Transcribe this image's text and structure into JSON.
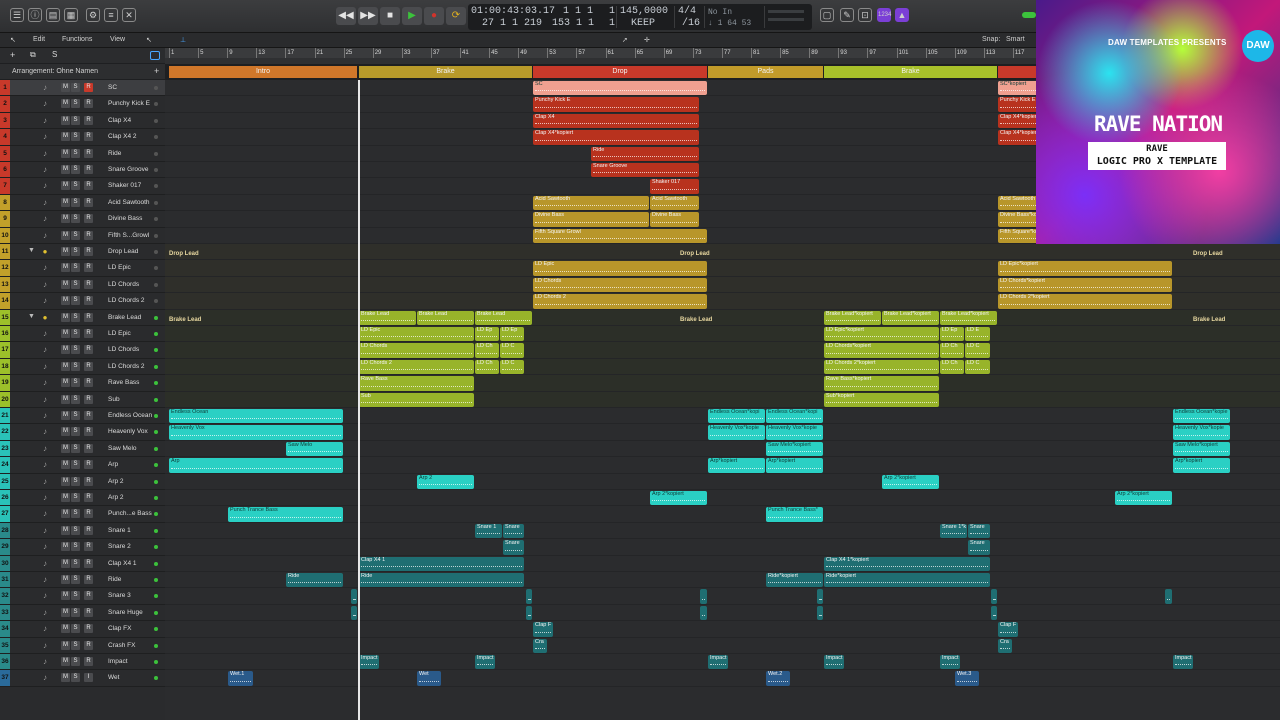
{
  "lcd": {
    "time": "01:00:43:03.17",
    "bars_beats": "1  1  1",
    "sub1": "1",
    "bars2": "27  1  1  219",
    "bars3": "153  1  1",
    "sub2": "1",
    "tempo": "145,0000",
    "tempo_mode": "KEEP",
    "signature": "4/4",
    "division": "/16",
    "in_label": "No In",
    "out_label": "↓ 1  64  53"
  },
  "menus": {
    "edit": "Edit",
    "functions": "Functions",
    "view": "View",
    "snap_label": "Snap:",
    "snap_value": "Smart"
  },
  "arrangement_label": "Arrangement: Ohne Namen",
  "ruler_ticks": [
    "1",
    "5",
    "9",
    "13",
    "17",
    "21",
    "25",
    "29",
    "33",
    "37",
    "41",
    "45",
    "49",
    "53",
    "57",
    "61",
    "65",
    "69",
    "73",
    "77",
    "81",
    "85",
    "89",
    "93",
    "97",
    "101",
    "105",
    "109",
    "113",
    "117",
    "121"
  ],
  "markers": [
    {
      "label": "Intro",
      "color": "#d0772a"
    },
    {
      "label": "Brake",
      "color": "#b89a2a"
    },
    {
      "label": "Drop",
      "color": "#c8392a"
    },
    {
      "label": "Pads",
      "color": "#c29b2a"
    },
    {
      "label": "Brake",
      "color": "#a8c02a"
    },
    {
      "label": "",
      "color": "#c8392a"
    }
  ],
  "tracks": [
    {
      "num": "1",
      "name": "SC",
      "color": "#c8392a"
    },
    {
      "num": "2",
      "name": "Punchy Kick E",
      "color": "#c8392a"
    },
    {
      "num": "3",
      "name": "Clap X4",
      "color": "#c8392a"
    },
    {
      "num": "4",
      "name": "Clap X4 2",
      "color": "#c8392a"
    },
    {
      "num": "5",
      "name": "Ride",
      "color": "#c8392a"
    },
    {
      "num": "6",
      "name": "Snare Groove",
      "color": "#c8392a"
    },
    {
      "num": "7",
      "name": "Shaker 017",
      "color": "#c8392a"
    },
    {
      "num": "8",
      "name": "Acid Sawtooth",
      "color": "#c2a02a"
    },
    {
      "num": "9",
      "name": "Divine Bass",
      "color": "#c2a02a"
    },
    {
      "num": "10",
      "name": "Fifth S...Growl",
      "color": "#c2a02a"
    },
    {
      "num": "11",
      "name": "Drop Lead",
      "color": "#c2a02a"
    },
    {
      "num": "12",
      "name": "LD Epic",
      "color": "#c2a02a"
    },
    {
      "num": "13",
      "name": "LD Chords",
      "color": "#c2a02a"
    },
    {
      "num": "14",
      "name": "LD Chords 2",
      "color": "#c2a02a"
    },
    {
      "num": "15",
      "name": "Brake Lead",
      "color": "#9cc02a"
    },
    {
      "num": "16",
      "name": "LD Epic",
      "color": "#9cc02a"
    },
    {
      "num": "17",
      "name": "LD Chords",
      "color": "#9cc02a"
    },
    {
      "num": "18",
      "name": "LD Chords 2",
      "color": "#9cc02a"
    },
    {
      "num": "19",
      "name": "Rave Bass",
      "color": "#9cc02a"
    },
    {
      "num": "20",
      "name": "Sub",
      "color": "#9cc02a"
    },
    {
      "num": "21",
      "name": "Endless Ocean",
      "color": "#2ac2b8"
    },
    {
      "num": "22",
      "name": "Heavenly Vox",
      "color": "#2ac2b8"
    },
    {
      "num": "23",
      "name": "Saw Melo",
      "color": "#2ac2b8"
    },
    {
      "num": "24",
      "name": "Arp",
      "color": "#2ac2b8"
    },
    {
      "num": "25",
      "name": "Arp 2",
      "color": "#2ac2b8"
    },
    {
      "num": "26",
      "name": "Arp 2",
      "color": "#2ac2b8"
    },
    {
      "num": "27",
      "name": "Punch...e Bass",
      "color": "#2ac2b8"
    },
    {
      "num": "28",
      "name": "Snare 1",
      "color": "#2a8a8a"
    },
    {
      "num": "29",
      "name": "Snare 2",
      "color": "#2a8a8a"
    },
    {
      "num": "30",
      "name": "Clap X4 1",
      "color": "#2a8a8a"
    },
    {
      "num": "31",
      "name": "Ride",
      "color": "#2a8a8a"
    },
    {
      "num": "32",
      "name": "Snare 3",
      "color": "#2a8a8a"
    },
    {
      "num": "33",
      "name": "Snare Huge",
      "color": "#2a8a8a"
    },
    {
      "num": "34",
      "name": "Clap FX",
      "color": "#2a8a8a"
    },
    {
      "num": "35",
      "name": "Crash FX",
      "color": "#2a8a8a"
    },
    {
      "num": "36",
      "name": "Impact",
      "color": "#2a8a8a"
    },
    {
      "num": "37",
      "name": "Wet",
      "color": "#2a6a9a"
    }
  ],
  "folder_labels": {
    "drop_lead_a": "Drop Lead",
    "drop_lead_b": "Drop Lead",
    "drop_lead_c": "Drop Lead",
    "brake_lead_a": "Brake Lead",
    "brake_lead_b": "Brake Lead",
    "brake_lead_c": "Brake Lead"
  },
  "regions": [
    {
      "lane": 0,
      "label": "SC",
      "color": "#f0a090",
      "start": 533,
      "end": 707
    },
    {
      "lane": 0,
      "label": "SC*kopiert",
      "color": "#f0a090",
      "start": 998,
      "end": 1040
    },
    {
      "lane": 1,
      "label": "Punchy Kick E",
      "color": "#b8321e",
      "start": 533,
      "end": 699
    },
    {
      "lane": 1,
      "label": "Punchy Kick E",
      "color": "#b8321e",
      "start": 998,
      "end": 1040
    },
    {
      "lane": 2,
      "label": "Clap X4",
      "color": "#b8321e",
      "start": 533,
      "end": 699
    },
    {
      "lane": 2,
      "label": "Clap X4*kopiert",
      "color": "#b8321e",
      "start": 998,
      "end": 1040
    },
    {
      "lane": 3,
      "label": "Clap X4*kopiert",
      "color": "#b8321e",
      "start": 533,
      "end": 699
    },
    {
      "lane": 3,
      "label": "Clap X4*kopiert",
      "color": "#b8321e",
      "start": 998,
      "end": 1040
    },
    {
      "lane": 4,
      "label": "Ride",
      "color": "#b8321e",
      "start": 591,
      "end": 699
    },
    {
      "lane": 5,
      "label": "Snare Groove",
      "color": "#b8321e",
      "start": 591,
      "end": 699
    },
    {
      "lane": 6,
      "label": "Shaker 017",
      "color": "#b8321e",
      "start": 650,
      "end": 699
    },
    {
      "lane": 7,
      "label": "Acid Sawtooth",
      "color": "#b8962a",
      "start": 533,
      "end": 649
    },
    {
      "lane": 7,
      "label": "Acid Sawtooth",
      "color": "#b8962a",
      "start": 650,
      "end": 699
    },
    {
      "lane": 7,
      "label": "Acid Sawtooth",
      "color": "#b8962a",
      "start": 998,
      "end": 1040
    },
    {
      "lane": 8,
      "label": "Divine Bass",
      "color": "#b8962a",
      "start": 533,
      "end": 649
    },
    {
      "lane": 8,
      "label": "Divine Bass",
      "color": "#b8962a",
      "start": 650,
      "end": 699
    },
    {
      "lane": 8,
      "label": "Divine Bass*kopiert",
      "color": "#b8962a",
      "start": 998,
      "end": 1040
    },
    {
      "lane": 9,
      "label": "Fifth Square Growl",
      "color": "#b8962a",
      "start": 533,
      "end": 707
    },
    {
      "lane": 9,
      "label": "Fifth Square*kopiert",
      "color": "#b8962a",
      "start": 998,
      "end": 1040
    },
    {
      "lane": 11,
      "label": "LD Epic",
      "color": "#b8962a",
      "start": 533,
      "end": 707
    },
    {
      "lane": 11,
      "label": "LD Epic*kopiert",
      "color": "#b8962a",
      "start": 998,
      "end": 1172
    },
    {
      "lane": 12,
      "label": "LD Chords",
      "color": "#b8962a",
      "start": 533,
      "end": 707
    },
    {
      "lane": 12,
      "label": "LD Chords*kopiert",
      "color": "#b8962a",
      "start": 998,
      "end": 1172
    },
    {
      "lane": 13,
      "label": "LD Chords 2",
      "color": "#b8962a",
      "start": 533,
      "end": 707
    },
    {
      "lane": 13,
      "label": "LD Chords 2*kopiert",
      "color": "#b8962a",
      "start": 998,
      "end": 1172
    },
    {
      "lane": 14,
      "label": "Brake Lead",
      "color": "#98b42a",
      "start": 359,
      "end": 416
    },
    {
      "lane": 14,
      "label": "Brake Lead",
      "color": "#98b42a",
      "start": 417,
      "end": 474
    },
    {
      "lane": 14,
      "label": "Brake Lead",
      "color": "#98b42a",
      "start": 475,
      "end": 532
    },
    {
      "lane": 14,
      "label": "Brake Lead*kopiert",
      "color": "#98b42a",
      "start": 824,
      "end": 881
    },
    {
      "lane": 14,
      "label": "Brake Lead*kopiert",
      "color": "#98b42a",
      "start": 882,
      "end": 939
    },
    {
      "lane": 14,
      "label": "Brake Lead*kopiert",
      "color": "#98b42a",
      "start": 940,
      "end": 997
    },
    {
      "lane": 15,
      "label": "LD Epic",
      "color": "#98b42a",
      "start": 359,
      "end": 474
    },
    {
      "lane": 15,
      "label": "LD Ep",
      "color": "#98b42a",
      "start": 475,
      "end": 499
    },
    {
      "lane": 15,
      "label": "LD Ep",
      "color": "#98b42a",
      "start": 500,
      "end": 524
    },
    {
      "lane": 15,
      "label": "LD Epic*kopiert",
      "color": "#98b42a",
      "start": 824,
      "end": 939
    },
    {
      "lane": 15,
      "label": "LD Ep",
      "color": "#98b42a",
      "start": 940,
      "end": 964
    },
    {
      "lane": 15,
      "label": "LD E",
      "color": "#98b42a",
      "start": 965,
      "end": 990
    },
    {
      "lane": 16,
      "label": "LD Chords",
      "color": "#98b42a",
      "start": 359,
      "end": 474
    },
    {
      "lane": 16,
      "label": "LD Ch",
      "color": "#98b42a",
      "start": 475,
      "end": 499
    },
    {
      "lane": 16,
      "label": "LD C",
      "color": "#98b42a",
      "start": 500,
      "end": 524
    },
    {
      "lane": 16,
      "label": "LD Chords*kopiert",
      "color": "#98b42a",
      "start": 824,
      "end": 939
    },
    {
      "lane": 16,
      "label": "LD Ch",
      "color": "#98b42a",
      "start": 940,
      "end": 964
    },
    {
      "lane": 16,
      "label": "LD C",
      "color": "#98b42a",
      "start": 965,
      "end": 990
    },
    {
      "lane": 17,
      "label": "LD Chords 2",
      "color": "#98b42a",
      "start": 359,
      "end": 474
    },
    {
      "lane": 17,
      "label": "LD Ch",
      "color": "#98b42a",
      "start": 475,
      "end": 499
    },
    {
      "lane": 17,
      "label": "LD C",
      "color": "#98b42a",
      "start": 500,
      "end": 524
    },
    {
      "lane": 17,
      "label": "LD Chords 2*kopiert",
      "color": "#98b42a",
      "start": 824,
      "end": 939
    },
    {
      "lane": 17,
      "label": "LD Ch",
      "color": "#98b42a",
      "start": 940,
      "end": 964
    },
    {
      "lane": 17,
      "label": "LD C",
      "color": "#98b42a",
      "start": 965,
      "end": 990
    },
    {
      "lane": 18,
      "label": "Rave Bass",
      "color": "#98b42a",
      "start": 359,
      "end": 474
    },
    {
      "lane": 18,
      "label": "Rave Bass*kopiert",
      "color": "#98b42a",
      "start": 824,
      "end": 939
    },
    {
      "lane": 19,
      "label": "Sub",
      "color": "#98b42a",
      "start": 359,
      "end": 474
    },
    {
      "lane": 19,
      "label": "Sub*kopiert",
      "color": "#98b42a",
      "start": 824,
      "end": 939
    },
    {
      "lane": 20,
      "label": "Endless Ocean",
      "color": "#2ad0c4",
      "start": 169,
      "end": 343
    },
    {
      "lane": 20,
      "label": "Endless Ocean*kopi",
      "color": "#2ad0c4",
      "start": 708,
      "end": 765
    },
    {
      "lane": 20,
      "label": "Endless Ocean*kopi",
      "color": "#2ad0c4",
      "start": 766,
      "end": 823
    },
    {
      "lane": 20,
      "label": "Endless Ocean*kopie",
      "color": "#2ad0c4",
      "start": 1173,
      "end": 1230
    },
    {
      "lane": 21,
      "label": "Heavenly Vox",
      "color": "#2ad0c4",
      "start": 169,
      "end": 343
    },
    {
      "lane": 21,
      "label": "Heavenly Vox*kopie",
      "color": "#2ad0c4",
      "start": 708,
      "end": 765
    },
    {
      "lane": 21,
      "label": "Heavenly Vox*kopie",
      "color": "#2ad0c4",
      "start": 766,
      "end": 823
    },
    {
      "lane": 21,
      "label": "Heavenly Vox*kopie",
      "color": "#2ad0c4",
      "start": 1173,
      "end": 1230
    },
    {
      "lane": 22,
      "label": "Saw Melo",
      "color": "#2ad0c4",
      "start": 286,
      "end": 343
    },
    {
      "lane": 22,
      "label": "Saw Melo*kopiert",
      "color": "#2ad0c4",
      "start": 766,
      "end": 823
    },
    {
      "lane": 22,
      "label": "Saw Melo*kopiert",
      "color": "#2ad0c4",
      "start": 1173,
      "end": 1230
    },
    {
      "lane": 23,
      "label": "Arp",
      "color": "#2ad0c4",
      "start": 169,
      "end": 343
    },
    {
      "lane": 23,
      "label": "Arp*kopiert",
      "color": "#2ad0c4",
      "start": 708,
      "end": 765
    },
    {
      "lane": 23,
      "label": "Arp*kopiert",
      "color": "#2ad0c4",
      "start": 766,
      "end": 823
    },
    {
      "lane": 23,
      "label": "Arp*kopiert",
      "color": "#2ad0c4",
      "start": 1173,
      "end": 1230
    },
    {
      "lane": 24,
      "label": "Arp 2",
      "color": "#2ad0c4",
      "start": 417,
      "end": 474
    },
    {
      "lane": 24,
      "label": "Arp 2*kopiert",
      "color": "#2ad0c4",
      "start": 882,
      "end": 939
    },
    {
      "lane": 25,
      "label": "Arp 2*kopiert",
      "color": "#2ad0c4",
      "start": 650,
      "end": 707
    },
    {
      "lane": 25,
      "label": "Arp 2*kopiert",
      "color": "#2ad0c4",
      "start": 1115,
      "end": 1172
    },
    {
      "lane": 26,
      "label": "Punch Trance Bass",
      "color": "#2ad0c4",
      "start": 228,
      "end": 343
    },
    {
      "lane": 26,
      "label": "Punch Trance Bass*",
      "color": "#2ad0c4",
      "start": 766,
      "end": 823
    },
    {
      "lane": 27,
      "label": "Snare 1",
      "color": "#1f6e72",
      "start": 475,
      "end": 502
    },
    {
      "lane": 27,
      "label": "Snare",
      "color": "#1f6e72",
      "start": 503,
      "end": 524
    },
    {
      "lane": 27,
      "label": "Snare 1*k",
      "color": "#1f6e72",
      "start": 940,
      "end": 967
    },
    {
      "lane": 27,
      "label": "Snare",
      "color": "#1f6e72",
      "start": 968,
      "end": 990
    },
    {
      "lane": 28,
      "label": "Snare",
      "color": "#1f6e72",
      "start": 503,
      "end": 524
    },
    {
      "lane": 28,
      "label": "Snare",
      "color": "#1f6e72",
      "start": 968,
      "end": 990
    },
    {
      "lane": 29,
      "label": "Clap X4 1",
      "color": "#1f6e72",
      "start": 359,
      "end": 524
    },
    {
      "lane": 29,
      "label": "Clap X4 1*kopiert",
      "color": "#1f6e72",
      "start": 824,
      "end": 990
    },
    {
      "lane": 30,
      "label": "Ride",
      "color": "#1f6e72",
      "start": 286,
      "end": 343
    },
    {
      "lane": 30,
      "label": "Ride",
      "color": "#1f6e72",
      "start": 359,
      "end": 524
    },
    {
      "lane": 30,
      "label": "Ride*kopiert",
      "color": "#1f6e72",
      "start": 766,
      "end": 823
    },
    {
      "lane": 30,
      "label": "Ride*kopiert",
      "color": "#1f6e72",
      "start": 824,
      "end": 990
    },
    {
      "lane": 31,
      "label": "",
      "color": "#1f6e72",
      "start": 351,
      "end": 357
    },
    {
      "lane": 31,
      "label": "",
      "color": "#1f6e72",
      "start": 526,
      "end": 532
    },
    {
      "lane": 31,
      "label": "",
      "color": "#1f6e72",
      "start": 700,
      "end": 707
    },
    {
      "lane": 31,
      "label": "",
      "color": "#1f6e72",
      "start": 817,
      "end": 823
    },
    {
      "lane": 31,
      "label": "",
      "color": "#1f6e72",
      "start": 991,
      "end": 997
    },
    {
      "lane": 31,
      "label": "",
      "color": "#1f6e72",
      "start": 1165,
      "end": 1172
    },
    {
      "lane": 32,
      "label": "",
      "color": "#1f6e72",
      "start": 351,
      "end": 357
    },
    {
      "lane": 32,
      "label": "",
      "color": "#1f6e72",
      "start": 526,
      "end": 532
    },
    {
      "lane": 32,
      "label": "",
      "color": "#1f6e72",
      "start": 700,
      "end": 707
    },
    {
      "lane": 32,
      "label": "",
      "color": "#1f6e72",
      "start": 817,
      "end": 823
    },
    {
      "lane": 32,
      "label": "",
      "color": "#1f6e72",
      "start": 991,
      "end": 997
    },
    {
      "lane": 33,
      "label": "Clap F",
      "color": "#1f6e72",
      "start": 533,
      "end": 553
    },
    {
      "lane": 33,
      "label": "Clap F",
      "color": "#1f6e72",
      "start": 998,
      "end": 1018
    },
    {
      "lane": 34,
      "label": "Cra",
      "color": "#1f6e72",
      "start": 533,
      "end": 547
    },
    {
      "lane": 34,
      "label": "Cra",
      "color": "#1f6e72",
      "start": 998,
      "end": 1012
    },
    {
      "lane": 35,
      "label": "Impact",
      "color": "#1f6e72",
      "start": 359,
      "end": 379
    },
    {
      "lane": 35,
      "label": "Impact",
      "color": "#1f6e72",
      "start": 475,
      "end": 495
    },
    {
      "lane": 35,
      "label": "Impact",
      "color": "#1f6e72",
      "start": 708,
      "end": 728
    },
    {
      "lane": 35,
      "label": "Impact",
      "color": "#1f6e72",
      "start": 824,
      "end": 844
    },
    {
      "lane": 35,
      "label": "Impact",
      "color": "#1f6e72",
      "start": 940,
      "end": 960
    },
    {
      "lane": 35,
      "label": "Impact",
      "color": "#1f6e72",
      "start": 1173,
      "end": 1193
    },
    {
      "lane": 36,
      "label": "Wet.1",
      "color": "#2a5a8a",
      "start": 228,
      "end": 253
    },
    {
      "lane": 36,
      "label": "Wet",
      "color": "#2a5a8a",
      "start": 417,
      "end": 441
    },
    {
      "lane": 36,
      "label": "Wet.2",
      "color": "#2a5a8a",
      "start": 766,
      "end": 790
    },
    {
      "lane": 36,
      "label": "Wet.3",
      "color": "#2a5a8a",
      "start": 955,
      "end": 979
    }
  ],
  "album_art": {
    "presenter": "DAW TEMPLATES PRESENTS",
    "logo": "DAW",
    "title": "RAVE NATION",
    "genre": "RAVE",
    "subtitle": "LOGIC PRO X TEMPLATE"
  },
  "colors": {
    "background": "#2b2c2e",
    "playhead": "#e8e8e8",
    "play_button": "#3cc23c",
    "record_button": "#d0342c",
    "cycle_button": "#e0b020"
  }
}
